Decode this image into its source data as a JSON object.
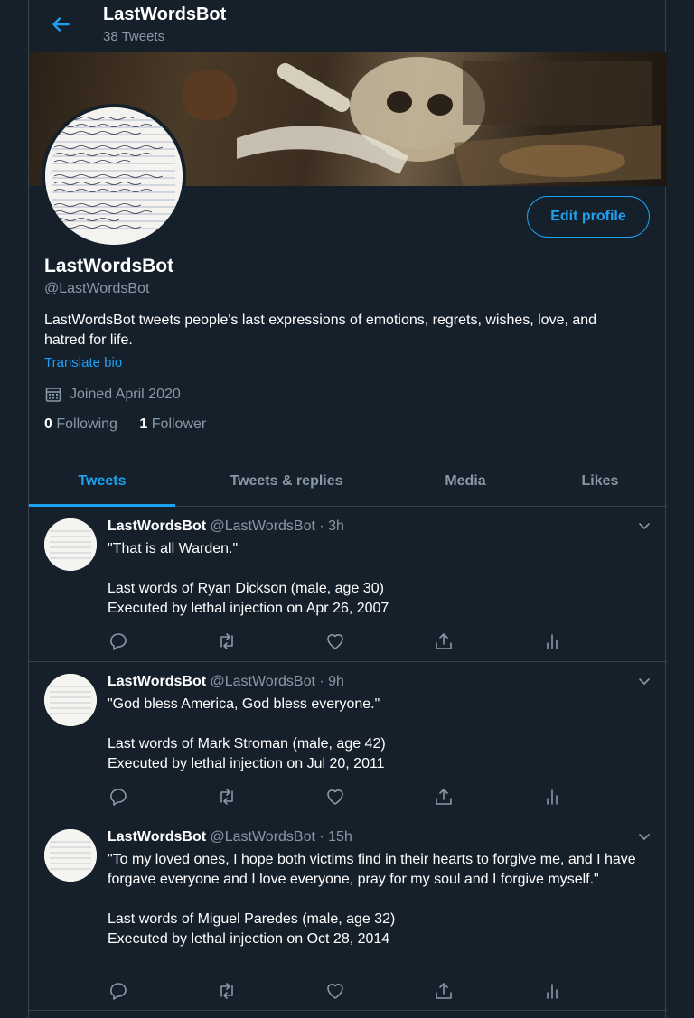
{
  "header": {
    "title": "LastWordsBot",
    "tweet_count": "38 Tweets"
  },
  "profile": {
    "name": "LastWordsBot",
    "handle": "@LastWordsBot",
    "bio": "LastWordsBot tweets people's last expressions of emotions, regrets, wishes, love, and hatred for life.",
    "translate": "Translate bio",
    "joined": "Joined April 2020",
    "following_count": "0",
    "following_label": "Following",
    "followers_count": "1",
    "followers_label": "Follower",
    "edit_label": "Edit profile"
  },
  "tabs": [
    {
      "label": "Tweets",
      "active": true
    },
    {
      "label": "Tweets & replies"
    },
    {
      "label": "Media"
    },
    {
      "label": "Likes"
    }
  ],
  "tweets": [
    {
      "name": "LastWordsBot",
      "handle_time": "@LastWordsBot · 3h",
      "text": "\"That is all Warden.\"\n\nLast words of Ryan Dickson (male, age 30)\nExecuted by lethal injection on Apr 26, 2007"
    },
    {
      "name": "LastWordsBot",
      "handle_time": "@LastWordsBot · 9h",
      "text": "\"God bless America, God bless everyone.\"\n\nLast words of Mark Stroman (male, age 42)\nExecuted by lethal injection on Jul 20, 2011"
    },
    {
      "name": "LastWordsBot",
      "handle_time": "@LastWordsBot · 15h",
      "text": "\"To my loved ones, I hope both victims find in their hearts to forgive me, and I have forgave everyone and I love everyone, pray for my soul and I forgive myself.\"\n\nLast words of Miguel Paredes (male, age 32)\nExecuted by lethal injection on Oct 28, 2014"
    }
  ],
  "icons": {
    "back": "arrow-left-icon",
    "calendar": "calendar-icon",
    "caret": "chevron-down-icon",
    "reply": "reply-icon",
    "retweet": "retweet-icon",
    "like": "heart-icon",
    "share": "share-icon",
    "analytics": "analytics-icon"
  },
  "colors": {
    "background": "#15202b",
    "accent": "#1da1f2",
    "muted": "#8899a6",
    "border": "#38444d"
  }
}
